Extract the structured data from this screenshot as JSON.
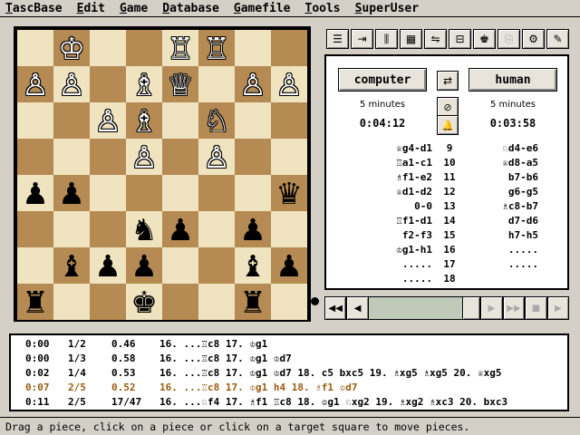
{
  "menu": [
    {
      "u": "T",
      "rest": "ascBase"
    },
    {
      "u": "E",
      "rest": "dit"
    },
    {
      "u": "G",
      "rest": "ame"
    },
    {
      "u": "D",
      "rest": "atabase"
    },
    {
      "u": "G",
      "rest": "amefile"
    },
    {
      "u": "T",
      "rest": "ools"
    },
    {
      "u": "S",
      "rest": "uperUser"
    }
  ],
  "board": [
    [
      " ",
      "♔",
      " ",
      " ",
      "♖",
      "♖",
      " ",
      " "
    ],
    [
      "♙",
      "♙",
      " ",
      "♗",
      "♕",
      " ",
      "♙",
      "♙"
    ],
    [
      " ",
      " ",
      "♙",
      "♗",
      " ",
      "♘",
      " ",
      " "
    ],
    [
      " ",
      " ",
      " ",
      "♙",
      " ",
      "♙",
      " ",
      " "
    ],
    [
      "♟",
      "♟",
      " ",
      " ",
      " ",
      " ",
      " ",
      "♛"
    ],
    [
      " ",
      " ",
      " ",
      "♞",
      "♟",
      " ",
      "♟",
      " "
    ],
    [
      " ",
      "♝",
      "♟",
      "♟",
      " ",
      " ",
      "♝",
      "♟"
    ],
    [
      "♜",
      " ",
      " ",
      "♚",
      " ",
      " ",
      "♜",
      " "
    ]
  ],
  "toolbar_icons": [
    "list-icon",
    "indent-icon",
    "columns-icon",
    "grid-icon",
    "flip-icon",
    "tree-icon",
    "engine-icon",
    "copy-icon",
    "settings-icon",
    "tools-icon"
  ],
  "game": {
    "white_player": "computer",
    "black_player": "human",
    "white_time_control": "5 minutes",
    "black_time_control": "5 minutes",
    "white_clock": "0:04:12",
    "black_clock": "0:03:58",
    "swap_glyph": "⇄",
    "clock_glyph": "⊘",
    "bell_glyph": "🔔"
  },
  "moves": [
    {
      "w": "♕g4-d1",
      "n": "9",
      "b": "♘d4-e6"
    },
    {
      "w": "♖a1-c1",
      "n": "10",
      "b": "♕d8-a5"
    },
    {
      "w": "♗f1-e2",
      "n": "11",
      "b": "b7-b6"
    },
    {
      "w": "♕d1-d2",
      "n": "12",
      "b": "g6-g5"
    },
    {
      "w": "0-0",
      "n": "13",
      "b": "♗c8-b7"
    },
    {
      "w": "♖f1-d1",
      "n": "14",
      "b": "d7-d6"
    },
    {
      "w": "f2-f3",
      "n": "15",
      "b": "h7-h5"
    },
    {
      "w": "♔g1-h1",
      "n": "16",
      "b": "....."
    },
    {
      "w": ".....",
      "n": "17",
      "b": "....."
    },
    {
      "w": ".....",
      "n": "18",
      "b": ""
    }
  ],
  "analysis": [
    {
      "time": "0:00",
      "depth": "1/2",
      "score": "0.46",
      "line": "16. ...♖c8 17. ♔g1"
    },
    {
      "time": "0:00",
      "depth": "1/3",
      "score": "0.58",
      "line": "16. ...♖c8 17. ♔g1 ♔d7"
    },
    {
      "time": "0:02",
      "depth": "1/4",
      "score": "0.53",
      "line": "16. ...♖c8 17. ♔g1 ♔d7 18. c5 bxc5 19. ♗xg5 ♗xg5 20. ♕xg5"
    },
    {
      "time": "0:07",
      "depth": "2/5",
      "score": "0.52",
      "line": "16. ...♖c8 17. ♔g1 h4 18. ♗f1 ♔d7",
      "current": true
    },
    {
      "time": "0:11",
      "depth": "2/5",
      "score": "17/47",
      "line": "16. ...♘f4 17. ♗f1 ♖c8 18. ♔g1 ♘xg2 19. ♗xg2 ♗xc3 20. bxc3"
    }
  ],
  "status": "Drag a piece, click on a piece or click on a target square to move pieces."
}
